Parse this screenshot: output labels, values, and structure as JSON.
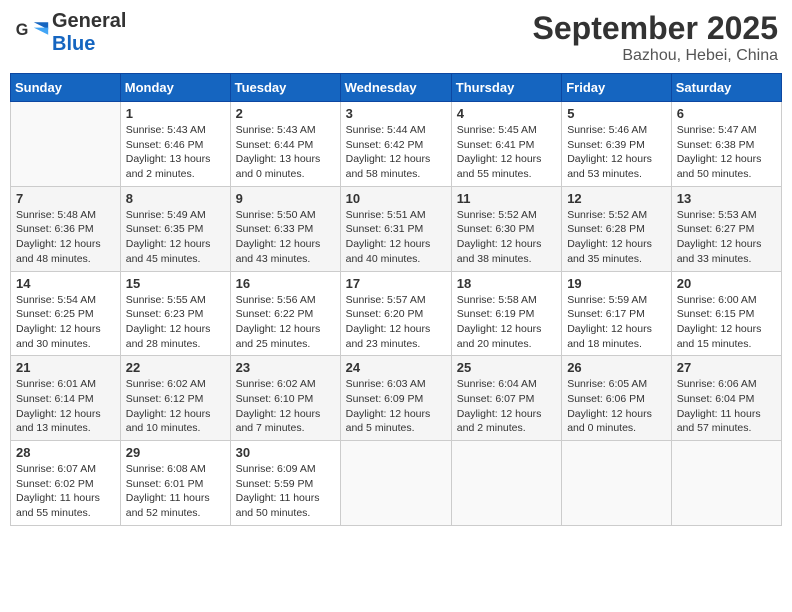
{
  "header": {
    "logo_line1": "General",
    "logo_line2": "Blue",
    "month": "September 2025",
    "location": "Bazhou, Hebei, China"
  },
  "days_of_week": [
    "Sunday",
    "Monday",
    "Tuesday",
    "Wednesday",
    "Thursday",
    "Friday",
    "Saturday"
  ],
  "weeks": [
    [
      {
        "num": "",
        "info": ""
      },
      {
        "num": "1",
        "info": "Sunrise: 5:43 AM\nSunset: 6:46 PM\nDaylight: 13 hours\nand 2 minutes."
      },
      {
        "num": "2",
        "info": "Sunrise: 5:43 AM\nSunset: 6:44 PM\nDaylight: 13 hours\nand 0 minutes."
      },
      {
        "num": "3",
        "info": "Sunrise: 5:44 AM\nSunset: 6:42 PM\nDaylight: 12 hours\nand 58 minutes."
      },
      {
        "num": "4",
        "info": "Sunrise: 5:45 AM\nSunset: 6:41 PM\nDaylight: 12 hours\nand 55 minutes."
      },
      {
        "num": "5",
        "info": "Sunrise: 5:46 AM\nSunset: 6:39 PM\nDaylight: 12 hours\nand 53 minutes."
      },
      {
        "num": "6",
        "info": "Sunrise: 5:47 AM\nSunset: 6:38 PM\nDaylight: 12 hours\nand 50 minutes."
      }
    ],
    [
      {
        "num": "7",
        "info": "Sunrise: 5:48 AM\nSunset: 6:36 PM\nDaylight: 12 hours\nand 48 minutes."
      },
      {
        "num": "8",
        "info": "Sunrise: 5:49 AM\nSunset: 6:35 PM\nDaylight: 12 hours\nand 45 minutes."
      },
      {
        "num": "9",
        "info": "Sunrise: 5:50 AM\nSunset: 6:33 PM\nDaylight: 12 hours\nand 43 minutes."
      },
      {
        "num": "10",
        "info": "Sunrise: 5:51 AM\nSunset: 6:31 PM\nDaylight: 12 hours\nand 40 minutes."
      },
      {
        "num": "11",
        "info": "Sunrise: 5:52 AM\nSunset: 6:30 PM\nDaylight: 12 hours\nand 38 minutes."
      },
      {
        "num": "12",
        "info": "Sunrise: 5:52 AM\nSunset: 6:28 PM\nDaylight: 12 hours\nand 35 minutes."
      },
      {
        "num": "13",
        "info": "Sunrise: 5:53 AM\nSunset: 6:27 PM\nDaylight: 12 hours\nand 33 minutes."
      }
    ],
    [
      {
        "num": "14",
        "info": "Sunrise: 5:54 AM\nSunset: 6:25 PM\nDaylight: 12 hours\nand 30 minutes."
      },
      {
        "num": "15",
        "info": "Sunrise: 5:55 AM\nSunset: 6:23 PM\nDaylight: 12 hours\nand 28 minutes."
      },
      {
        "num": "16",
        "info": "Sunrise: 5:56 AM\nSunset: 6:22 PM\nDaylight: 12 hours\nand 25 minutes."
      },
      {
        "num": "17",
        "info": "Sunrise: 5:57 AM\nSunset: 6:20 PM\nDaylight: 12 hours\nand 23 minutes."
      },
      {
        "num": "18",
        "info": "Sunrise: 5:58 AM\nSunset: 6:19 PM\nDaylight: 12 hours\nand 20 minutes."
      },
      {
        "num": "19",
        "info": "Sunrise: 5:59 AM\nSunset: 6:17 PM\nDaylight: 12 hours\nand 18 minutes."
      },
      {
        "num": "20",
        "info": "Sunrise: 6:00 AM\nSunset: 6:15 PM\nDaylight: 12 hours\nand 15 minutes."
      }
    ],
    [
      {
        "num": "21",
        "info": "Sunrise: 6:01 AM\nSunset: 6:14 PM\nDaylight: 12 hours\nand 13 minutes."
      },
      {
        "num": "22",
        "info": "Sunrise: 6:02 AM\nSunset: 6:12 PM\nDaylight: 12 hours\nand 10 minutes."
      },
      {
        "num": "23",
        "info": "Sunrise: 6:02 AM\nSunset: 6:10 PM\nDaylight: 12 hours\nand 7 minutes."
      },
      {
        "num": "24",
        "info": "Sunrise: 6:03 AM\nSunset: 6:09 PM\nDaylight: 12 hours\nand 5 minutes."
      },
      {
        "num": "25",
        "info": "Sunrise: 6:04 AM\nSunset: 6:07 PM\nDaylight: 12 hours\nand 2 minutes."
      },
      {
        "num": "26",
        "info": "Sunrise: 6:05 AM\nSunset: 6:06 PM\nDaylight: 12 hours\nand 0 minutes."
      },
      {
        "num": "27",
        "info": "Sunrise: 6:06 AM\nSunset: 6:04 PM\nDaylight: 11 hours\nand 57 minutes."
      }
    ],
    [
      {
        "num": "28",
        "info": "Sunrise: 6:07 AM\nSunset: 6:02 PM\nDaylight: 11 hours\nand 55 minutes."
      },
      {
        "num": "29",
        "info": "Sunrise: 6:08 AM\nSunset: 6:01 PM\nDaylight: 11 hours\nand 52 minutes."
      },
      {
        "num": "30",
        "info": "Sunrise: 6:09 AM\nSunset: 5:59 PM\nDaylight: 11 hours\nand 50 minutes."
      },
      {
        "num": "",
        "info": ""
      },
      {
        "num": "",
        "info": ""
      },
      {
        "num": "",
        "info": ""
      },
      {
        "num": "",
        "info": ""
      }
    ]
  ]
}
